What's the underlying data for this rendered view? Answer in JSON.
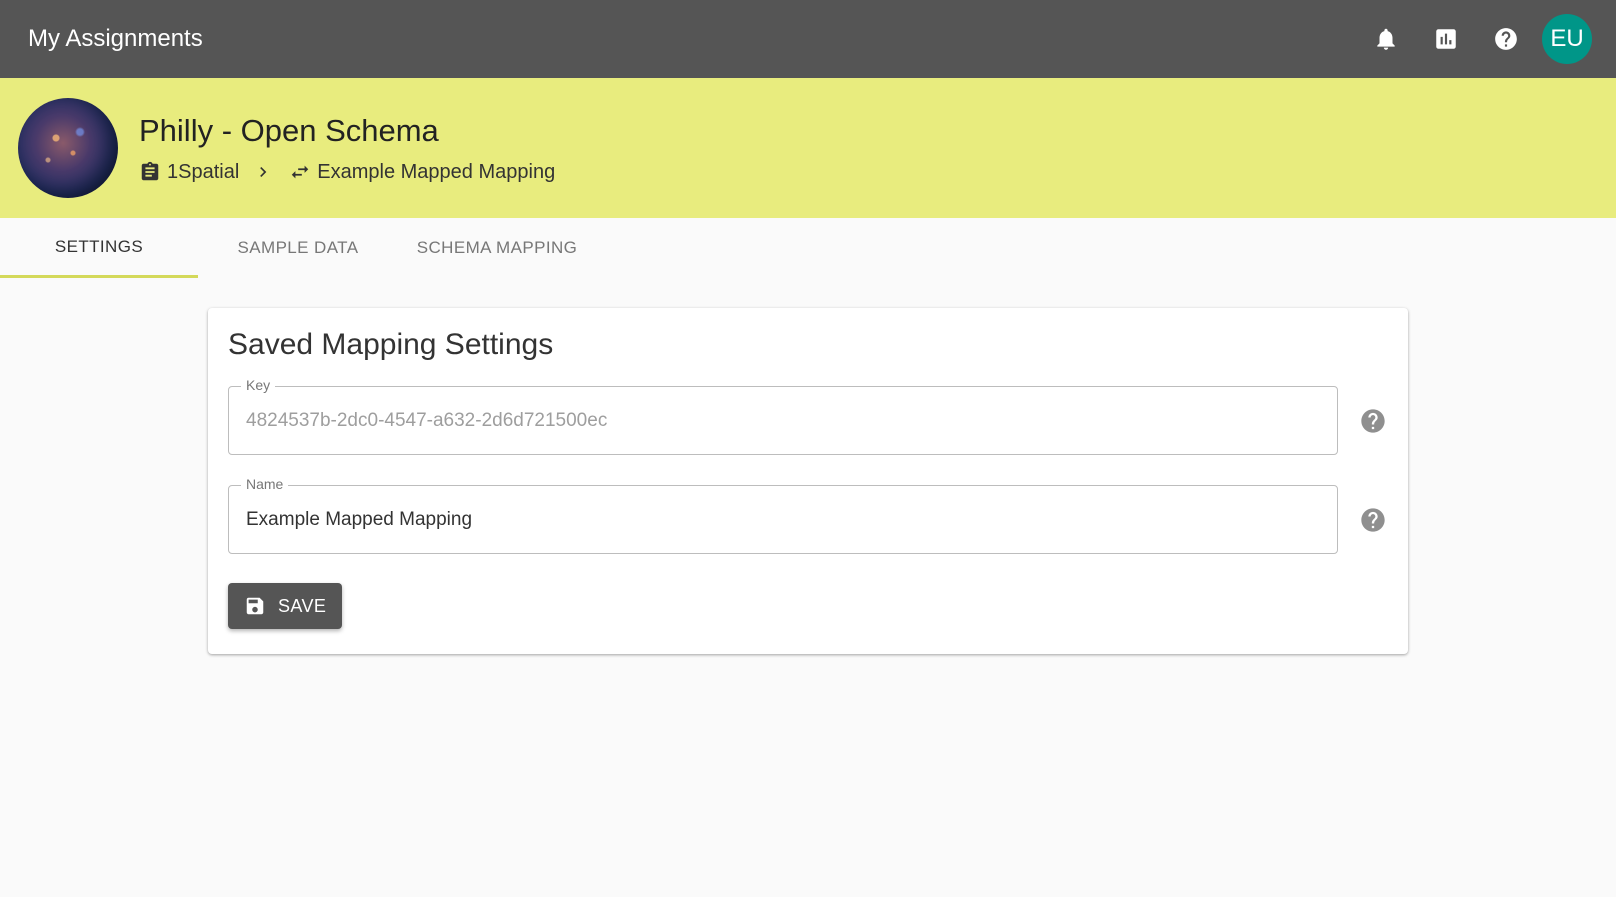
{
  "topbar": {
    "title": "My Assignments",
    "icons": [
      "bell-icon",
      "chart-icon",
      "help-icon"
    ],
    "avatar_initials": "EU",
    "avatar_color": "#009688"
  },
  "project": {
    "title": "Philly - Open Schema",
    "breadcrumb": {
      "organization": "1Spatial",
      "mapping": "Example Mapped Mapping"
    }
  },
  "tabs": [
    {
      "label": "SETTINGS",
      "active": true
    },
    {
      "label": "SAMPLE DATA",
      "active": false
    },
    {
      "label": "SCHEMA MAPPING",
      "active": false
    }
  ],
  "settings_card": {
    "title": "Saved Mapping Settings",
    "key_field": {
      "label": "Key",
      "value": "4824537b-2dc0-4547-a632-2d6d721500ec"
    },
    "name_field": {
      "label": "Name",
      "value": "Example Mapped Mapping"
    },
    "save_label": "SAVE"
  },
  "colors": {
    "topbar": "#555555",
    "banner": "#e8ec7e",
    "active_tab_underline": "#d4d95a"
  }
}
